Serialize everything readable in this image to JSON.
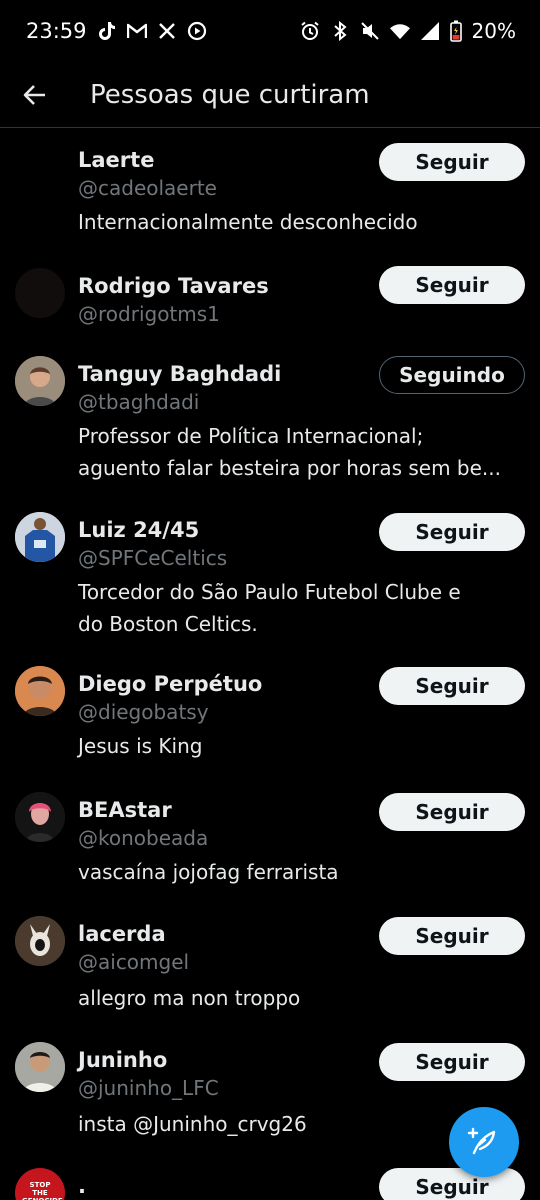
{
  "status_bar": {
    "time": "23:59",
    "battery": "20%",
    "left_icons": [
      "tiktok-icon",
      "gmail-icon",
      "x-icon",
      "media-icon"
    ],
    "right_icons": [
      "alarm-icon",
      "bluetooth-icon",
      "mute-icon",
      "wifi-icon",
      "signal-icon",
      "battery-icon"
    ]
  },
  "header": {
    "title": "Pessoas que curtiram"
  },
  "users": [
    {
      "name": "Laerte",
      "handle": "@cadeolaerte",
      "bio": "Internacionalmente desconhecido",
      "button": "Seguir",
      "following": false,
      "avatar_color": "#000000"
    },
    {
      "name": "Rodrigo Tavares",
      "handle": "@rodrigotms1",
      "bio": "",
      "button": "Seguir",
      "following": false,
      "avatar_color": "#120d0d"
    },
    {
      "name": "Tanguy Baghdadi",
      "handle": "@tbaghdadi",
      "bio_line1": "Professor de Política Internacional;",
      "bio_line2": "aguento falar besteira por horas sem be...",
      "button": "Seguindo",
      "following": true,
      "avatar_color": "#8a7b6a"
    },
    {
      "name": "Luiz 24/45",
      "handle": "@SPFCeCeltics",
      "bio_line1": "Torcedor do São Paulo Futebol Clube e",
      "bio_line2": "do Boston Celtics.",
      "button": "Seguir",
      "following": false,
      "avatar_color": "#2a4d8c"
    },
    {
      "name": "Diego Perpétuo",
      "handle": "@diegobatsy",
      "bio": "Jesus is King",
      "button": "Seguir",
      "following": false,
      "avatar_color": "#c26a3d"
    },
    {
      "name": "BEAstar",
      "handle": "@konobeada",
      "bio": "vascaína jojofag ferrarista",
      "button": "Seguir",
      "following": false,
      "avatar_color": "#1a1a1a"
    },
    {
      "name": "lacerda",
      "handle": "@aicomgel",
      "bio": "allegro ma non troppo",
      "button": "Seguir",
      "following": false,
      "avatar_color": "#3b3128"
    },
    {
      "name": "Juninho",
      "handle": "@juninho_LFC",
      "bio": "insta @Juninho_crvg26",
      "button": "Seguir",
      "following": false,
      "avatar_color": "#9c9c96"
    },
    {
      "name": ".",
      "avatar_text": "STOP THE GENOCIDE",
      "button": "Seguir",
      "following": false,
      "avatar_color": "#c4161c"
    }
  ],
  "fab": {
    "icon": "compose-icon",
    "color": "#1d9bf0"
  }
}
